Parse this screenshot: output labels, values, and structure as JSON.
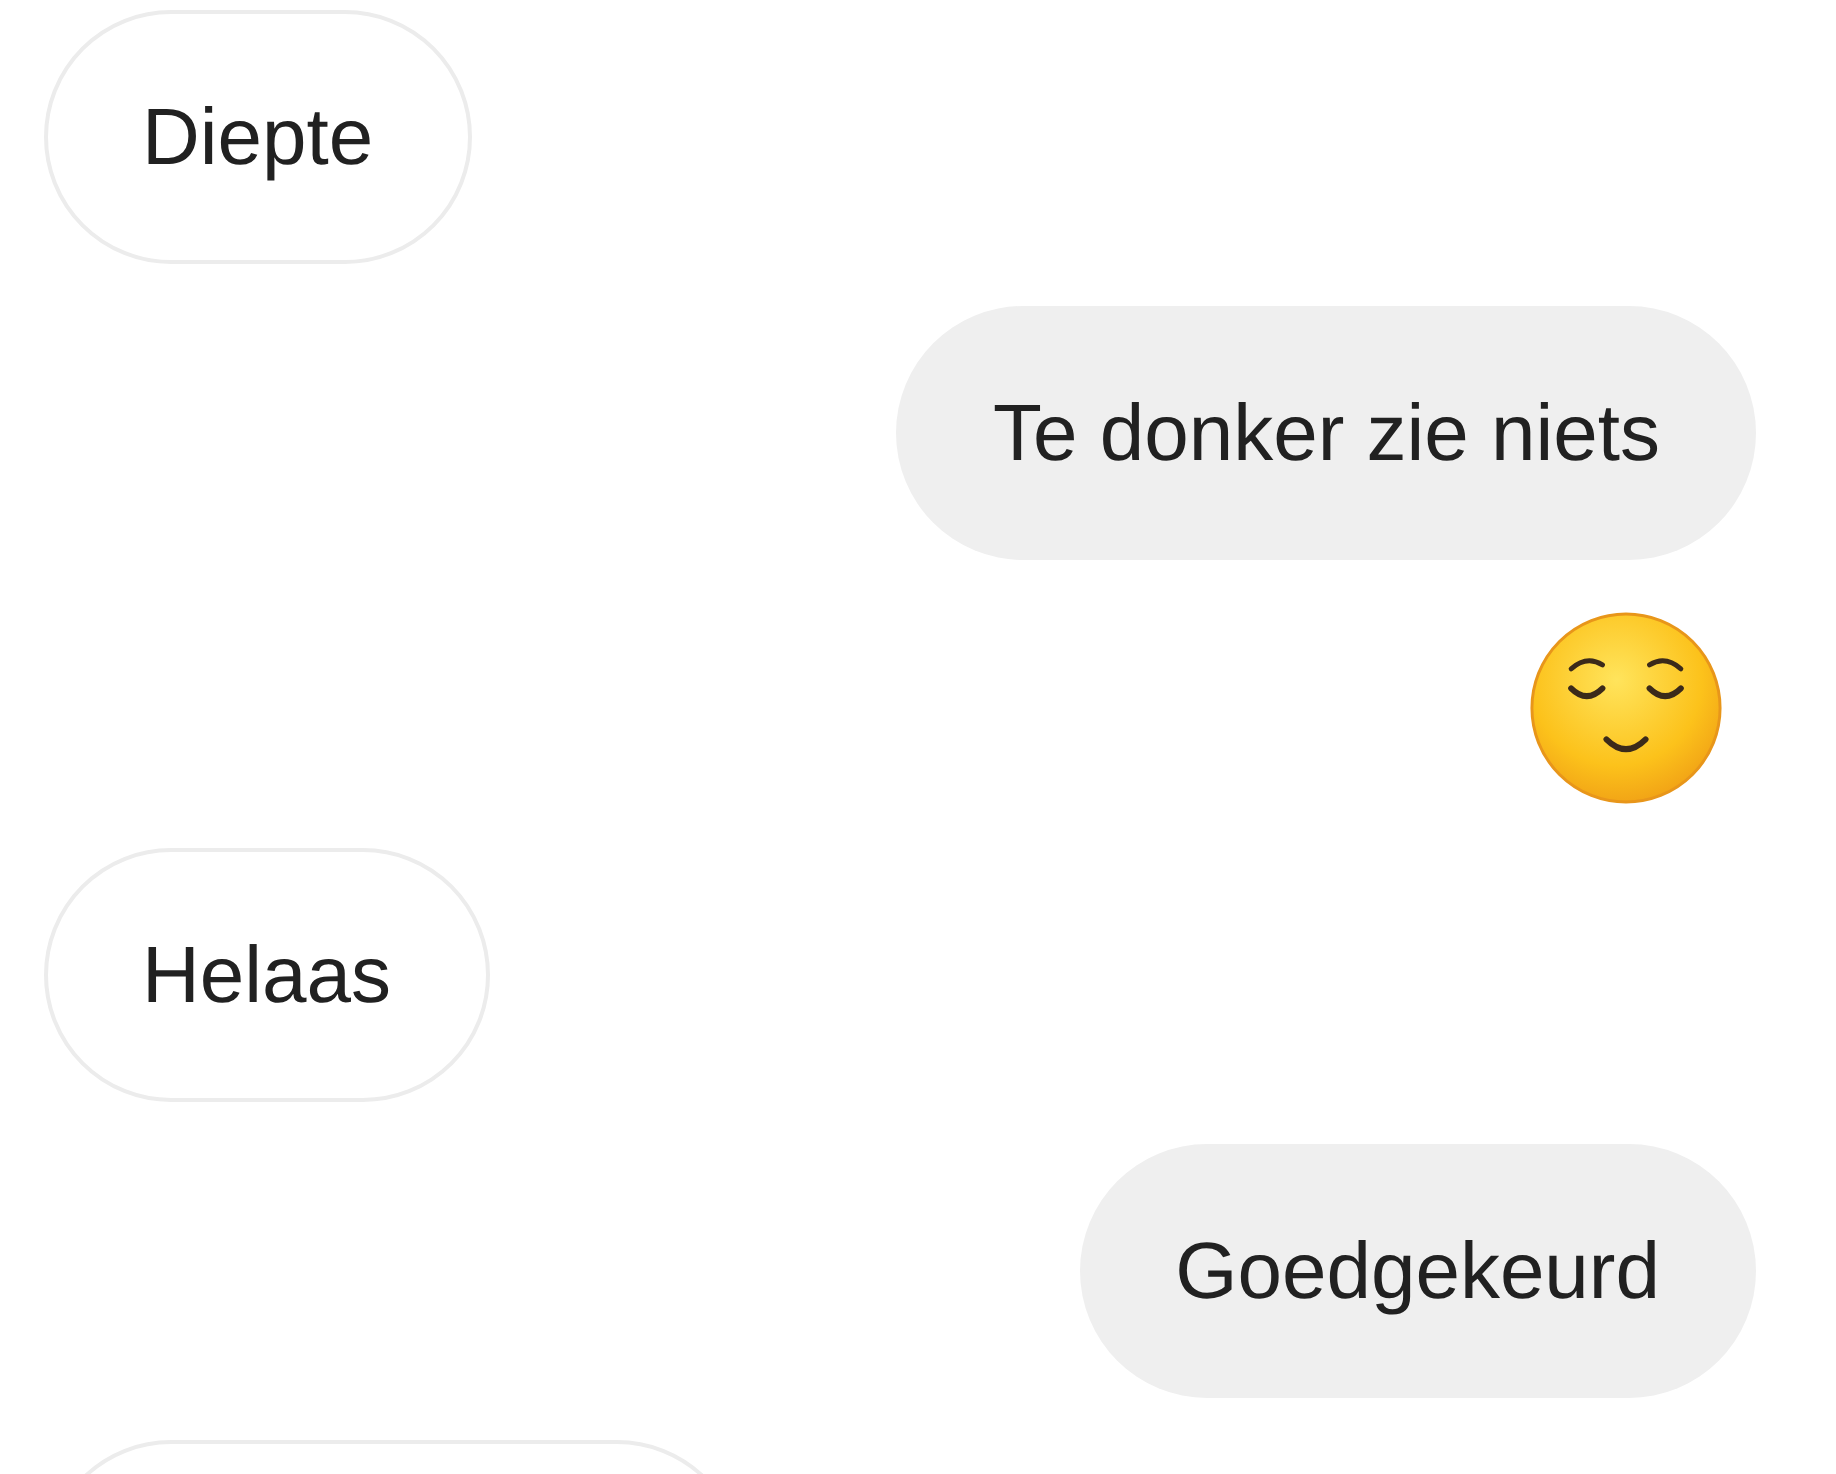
{
  "messages": [
    {
      "sent": false,
      "kind": "text",
      "text": "Diepte"
    },
    {
      "sent": true,
      "kind": "text",
      "text": "Te donker zie niets"
    },
    {
      "sent": true,
      "kind": "emoji"
    },
    {
      "sent": false,
      "kind": "text",
      "text": "Helaas"
    },
    {
      "sent": true,
      "kind": "text",
      "text": "Goedgekeurd"
    },
    {
      "sent": false,
      "kind": "cut"
    }
  ]
}
